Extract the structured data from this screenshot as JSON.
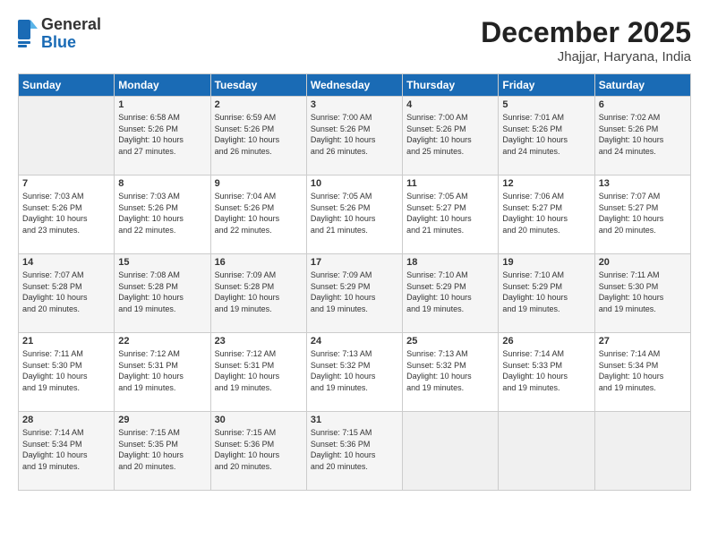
{
  "logo": {
    "general": "General",
    "blue": "Blue"
  },
  "header": {
    "month": "December 2025",
    "location": "Jhajjar, Haryana, India"
  },
  "days_of_week": [
    "Sunday",
    "Monday",
    "Tuesday",
    "Wednesday",
    "Thursday",
    "Friday",
    "Saturday"
  ],
  "weeks": [
    [
      {
        "day": "",
        "info": ""
      },
      {
        "day": "1",
        "info": "Sunrise: 6:58 AM\nSunset: 5:26 PM\nDaylight: 10 hours\nand 27 minutes."
      },
      {
        "day": "2",
        "info": "Sunrise: 6:59 AM\nSunset: 5:26 PM\nDaylight: 10 hours\nand 26 minutes."
      },
      {
        "day": "3",
        "info": "Sunrise: 7:00 AM\nSunset: 5:26 PM\nDaylight: 10 hours\nand 26 minutes."
      },
      {
        "day": "4",
        "info": "Sunrise: 7:00 AM\nSunset: 5:26 PM\nDaylight: 10 hours\nand 25 minutes."
      },
      {
        "day": "5",
        "info": "Sunrise: 7:01 AM\nSunset: 5:26 PM\nDaylight: 10 hours\nand 24 minutes."
      },
      {
        "day": "6",
        "info": "Sunrise: 7:02 AM\nSunset: 5:26 PM\nDaylight: 10 hours\nand 24 minutes."
      }
    ],
    [
      {
        "day": "7",
        "info": "Sunrise: 7:03 AM\nSunset: 5:26 PM\nDaylight: 10 hours\nand 23 minutes."
      },
      {
        "day": "8",
        "info": "Sunrise: 7:03 AM\nSunset: 5:26 PM\nDaylight: 10 hours\nand 22 minutes."
      },
      {
        "day": "9",
        "info": "Sunrise: 7:04 AM\nSunset: 5:26 PM\nDaylight: 10 hours\nand 22 minutes."
      },
      {
        "day": "10",
        "info": "Sunrise: 7:05 AM\nSunset: 5:26 PM\nDaylight: 10 hours\nand 21 minutes."
      },
      {
        "day": "11",
        "info": "Sunrise: 7:05 AM\nSunset: 5:27 PM\nDaylight: 10 hours\nand 21 minutes."
      },
      {
        "day": "12",
        "info": "Sunrise: 7:06 AM\nSunset: 5:27 PM\nDaylight: 10 hours\nand 20 minutes."
      },
      {
        "day": "13",
        "info": "Sunrise: 7:07 AM\nSunset: 5:27 PM\nDaylight: 10 hours\nand 20 minutes."
      }
    ],
    [
      {
        "day": "14",
        "info": "Sunrise: 7:07 AM\nSunset: 5:28 PM\nDaylight: 10 hours\nand 20 minutes."
      },
      {
        "day": "15",
        "info": "Sunrise: 7:08 AM\nSunset: 5:28 PM\nDaylight: 10 hours\nand 19 minutes."
      },
      {
        "day": "16",
        "info": "Sunrise: 7:09 AM\nSunset: 5:28 PM\nDaylight: 10 hours\nand 19 minutes."
      },
      {
        "day": "17",
        "info": "Sunrise: 7:09 AM\nSunset: 5:29 PM\nDaylight: 10 hours\nand 19 minutes."
      },
      {
        "day": "18",
        "info": "Sunrise: 7:10 AM\nSunset: 5:29 PM\nDaylight: 10 hours\nand 19 minutes."
      },
      {
        "day": "19",
        "info": "Sunrise: 7:10 AM\nSunset: 5:29 PM\nDaylight: 10 hours\nand 19 minutes."
      },
      {
        "day": "20",
        "info": "Sunrise: 7:11 AM\nSunset: 5:30 PM\nDaylight: 10 hours\nand 19 minutes."
      }
    ],
    [
      {
        "day": "21",
        "info": "Sunrise: 7:11 AM\nSunset: 5:30 PM\nDaylight: 10 hours\nand 19 minutes."
      },
      {
        "day": "22",
        "info": "Sunrise: 7:12 AM\nSunset: 5:31 PM\nDaylight: 10 hours\nand 19 minutes."
      },
      {
        "day": "23",
        "info": "Sunrise: 7:12 AM\nSunset: 5:31 PM\nDaylight: 10 hours\nand 19 minutes."
      },
      {
        "day": "24",
        "info": "Sunrise: 7:13 AM\nSunset: 5:32 PM\nDaylight: 10 hours\nand 19 minutes."
      },
      {
        "day": "25",
        "info": "Sunrise: 7:13 AM\nSunset: 5:32 PM\nDaylight: 10 hours\nand 19 minutes."
      },
      {
        "day": "26",
        "info": "Sunrise: 7:14 AM\nSunset: 5:33 PM\nDaylight: 10 hours\nand 19 minutes."
      },
      {
        "day": "27",
        "info": "Sunrise: 7:14 AM\nSunset: 5:34 PM\nDaylight: 10 hours\nand 19 minutes."
      }
    ],
    [
      {
        "day": "28",
        "info": "Sunrise: 7:14 AM\nSunset: 5:34 PM\nDaylight: 10 hours\nand 19 minutes."
      },
      {
        "day": "29",
        "info": "Sunrise: 7:15 AM\nSunset: 5:35 PM\nDaylight: 10 hours\nand 20 minutes."
      },
      {
        "day": "30",
        "info": "Sunrise: 7:15 AM\nSunset: 5:36 PM\nDaylight: 10 hours\nand 20 minutes."
      },
      {
        "day": "31",
        "info": "Sunrise: 7:15 AM\nSunset: 5:36 PM\nDaylight: 10 hours\nand 20 minutes."
      },
      {
        "day": "",
        "info": ""
      },
      {
        "day": "",
        "info": ""
      },
      {
        "day": "",
        "info": ""
      }
    ]
  ]
}
